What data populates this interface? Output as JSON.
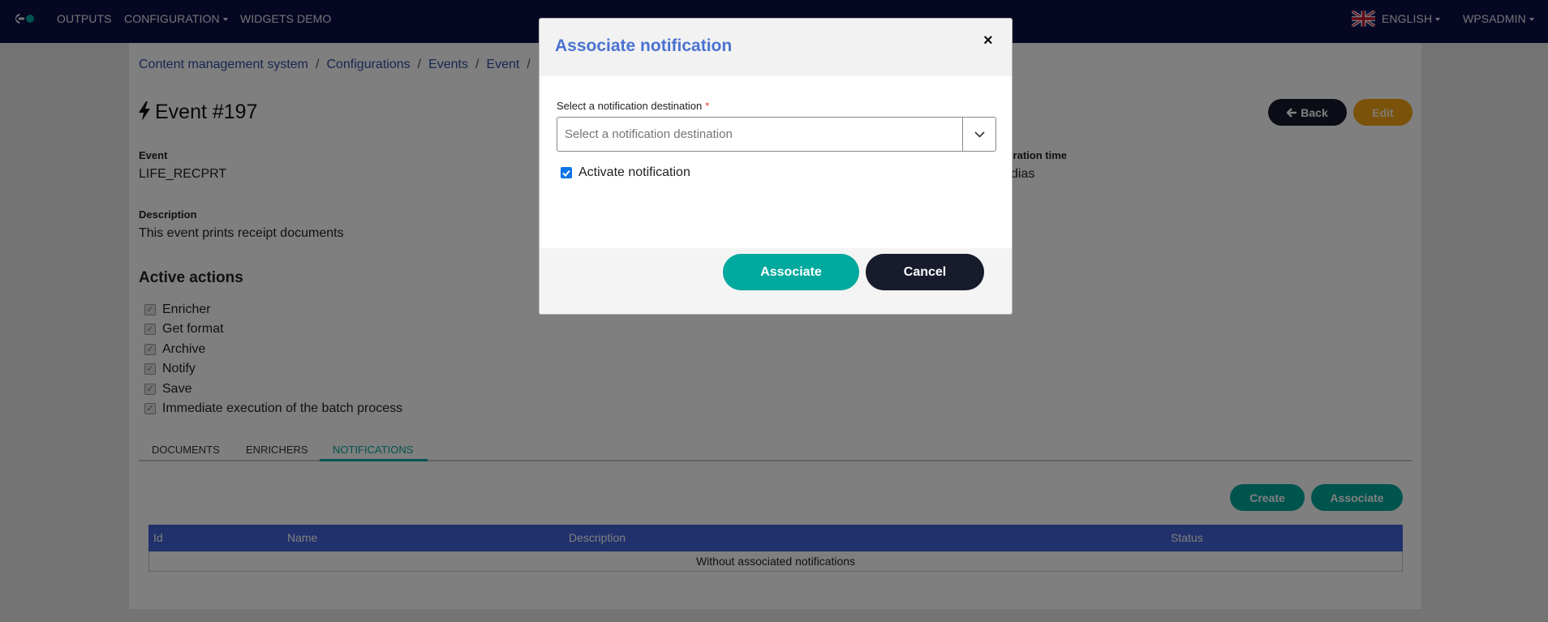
{
  "nav": {
    "items": [
      {
        "label": "OUTPUTS",
        "has_caret": false
      },
      {
        "label": "CONFIGURATION",
        "has_caret": true
      },
      {
        "label": "WIDGETS DEMO",
        "has_caret": false
      }
    ],
    "language": "ENGLISH",
    "user": "WPSADMIN"
  },
  "breadcrumb": [
    "Content management system",
    "Configurations",
    "Events",
    "Event"
  ],
  "page": {
    "title": "Event #197",
    "back_label": "Back",
    "edit_label": "Edit",
    "event_label": "Event",
    "event_value": "LIFE_RECPRT",
    "description_label": "Description",
    "description_value": "This event prints receipt documents",
    "expiration_label_partial": "piration time",
    "expiration_value_partial": "dias",
    "active_actions_title": "Active actions",
    "actions": [
      "Enricher",
      "Get format",
      "Archive",
      "Notify",
      "Save",
      "Immediate execution of the batch process"
    ]
  },
  "tabs": {
    "items": [
      "DOCUMENTS",
      "ENRICHERS",
      "NOTIFICATIONS"
    ],
    "active": "NOTIFICATIONS"
  },
  "notifications": {
    "create_label": "Create",
    "associate_label": "Associate",
    "columns": [
      "Id",
      "Name",
      "Description",
      "Status"
    ],
    "empty_text": "Without associated notifications"
  },
  "modal": {
    "title": "Associate notification",
    "close_symbol": "×",
    "select_label": "Select a notification destination",
    "required_mark": "*",
    "select_placeholder": "Select a notification destination",
    "activate_label": "Activate notification",
    "activate_checked": true,
    "associate_label": "Associate",
    "cancel_label": "Cancel"
  },
  "colors": {
    "navbar": "#0d0e45",
    "teal": "#00a99d",
    "dark_button": "#171b2c",
    "edit_button": "#f5a515",
    "table_header": "#4363d8",
    "modal_title": "#4a73d1",
    "link": "#2e4fa0"
  }
}
